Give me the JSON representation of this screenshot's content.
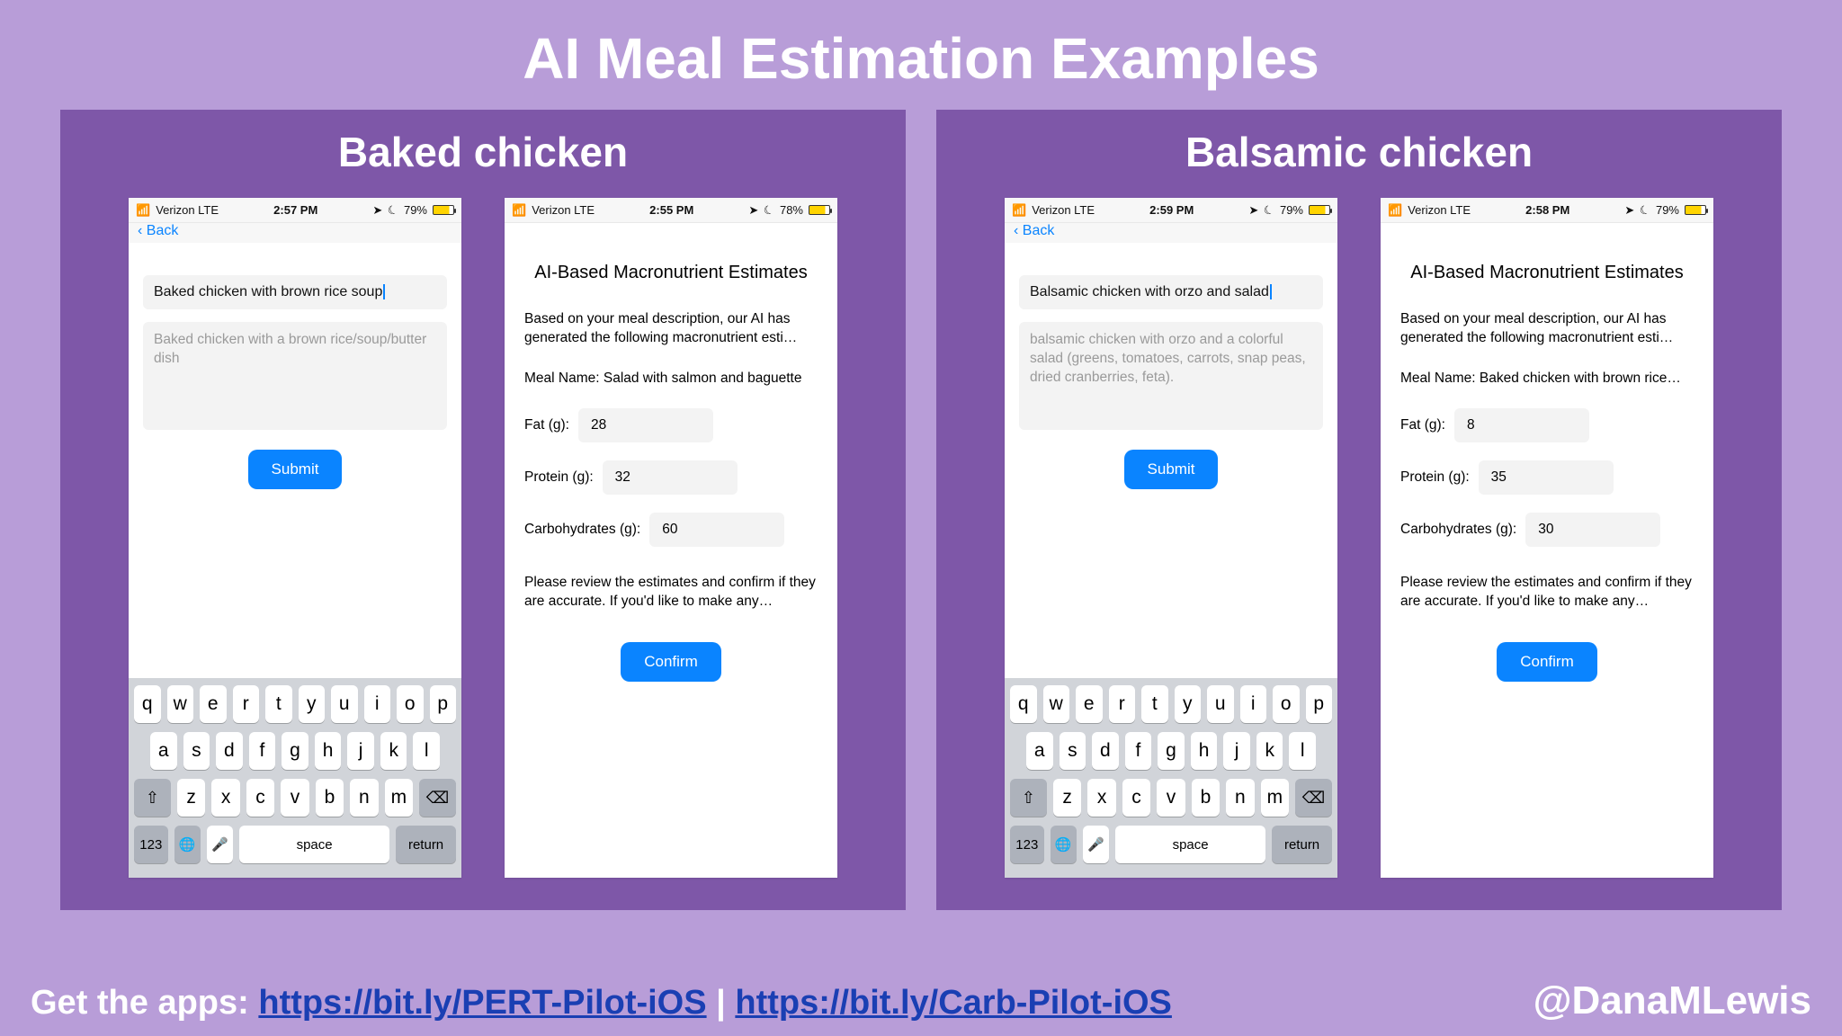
{
  "title": "AI Meal Estimation Examples",
  "footer": {
    "prefix": "Get the apps: ",
    "link1": "https://bit.ly/PERT-Pilot-iOS",
    "sep": " | ",
    "link2": "https://bit.ly/Carb-Pilot-iOS",
    "handle": "@DanaMLewis"
  },
  "keyboard": {
    "row1": [
      "q",
      "w",
      "e",
      "r",
      "t",
      "y",
      "u",
      "i",
      "o",
      "p"
    ],
    "row2": [
      "a",
      "s",
      "d",
      "f",
      "g",
      "h",
      "j",
      "k",
      "l"
    ],
    "row3": [
      "z",
      "x",
      "c",
      "v",
      "b",
      "n",
      "m"
    ],
    "shift": "⇧",
    "backspace": "⌫",
    "n123": "123",
    "globe": "🌐",
    "mic": "🎤",
    "space": "space",
    "return": "return"
  },
  "panels": [
    {
      "title": "Baked chicken",
      "input": {
        "status": {
          "carrier": "Verizon  LTE",
          "time": "2:57 PM",
          "batt": "79%"
        },
        "nav_back": "‹ Back",
        "value": "Baked chicken with brown rice soup",
        "placeholder": "Baked chicken with a brown rice/soup/butter dish",
        "submit": "Submit"
      },
      "est": {
        "status": {
          "carrier": "Verizon  LTE",
          "time": "2:55 PM",
          "batt": "78%"
        },
        "heading": "AI-Based Macronutrient Estimates",
        "intro": "Based on your meal description, our AI has generated the following macronutrient esti…",
        "meal_name_label": "Meal Name:",
        "meal_name": "Salad with salmon and baguette",
        "fat_label": "Fat (g):",
        "fat": "28",
        "protein_label": "Protein (g):",
        "protein": "32",
        "carb_label": "Carbohydrates (g):",
        "carb": "60",
        "review": "Please review the estimates and confirm if they are accurate. If you'd like to make any…",
        "confirm": "Confirm"
      }
    },
    {
      "title": "Balsamic chicken",
      "input": {
        "status": {
          "carrier": "Verizon  LTE",
          "time": "2:59 PM",
          "batt": "79%"
        },
        "nav_back": "‹ Back",
        "value": "Balsamic chicken with orzo and salad",
        "placeholder": "balsamic chicken with orzo and a colorful salad (greens, tomatoes, carrots, snap peas, dried cranberries, feta).",
        "submit": "Submit"
      },
      "est": {
        "status": {
          "carrier": "Verizon  LTE",
          "time": "2:58 PM",
          "batt": "79%"
        },
        "heading": "AI-Based Macronutrient Estimates",
        "intro": "Based on your meal description, our AI has generated the following macronutrient esti…",
        "meal_name_label": "Meal Name:",
        "meal_name": "Baked chicken with brown rice…",
        "fat_label": "Fat (g):",
        "fat": "8",
        "protein_label": "Protein (g):",
        "protein": "35",
        "carb_label": "Carbohydrates (g):",
        "carb": "30",
        "review": "Please review the estimates and confirm if they are accurate. If you'd like to make any…",
        "confirm": "Confirm"
      }
    }
  ]
}
